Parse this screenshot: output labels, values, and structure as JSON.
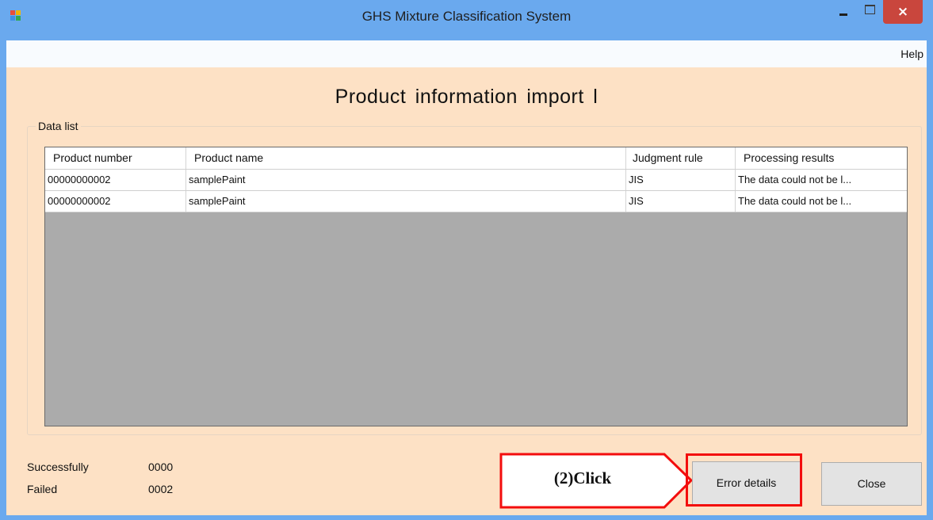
{
  "window": {
    "title": "GHS Mixture Classification System",
    "controls": {
      "close": "×"
    },
    "colors": {
      "titlebar": "#6aa9ee",
      "client": "#fde1c5",
      "close": "#c9463d",
      "highlight": "#f30d0d"
    }
  },
  "menu": {
    "help": "Help"
  },
  "heading": "Product information import l",
  "data_list": {
    "legend": "Data list",
    "columns": [
      "Product number",
      "Product name",
      "Judgment rule",
      "Processing results"
    ],
    "rows": [
      [
        "00000000002",
        "samplePaint",
        "JIS",
        "The data could not be l..."
      ],
      [
        "00000000002",
        "samplePaint",
        "JIS",
        "The data could not be l..."
      ]
    ]
  },
  "status": {
    "success_label": "Successfully",
    "success_count": "0000",
    "failed_label": "Failed",
    "failed_count": "0002"
  },
  "buttons": {
    "error_details": "Error details",
    "close": "Close"
  },
  "annotation": {
    "callout": "(2)Click"
  }
}
